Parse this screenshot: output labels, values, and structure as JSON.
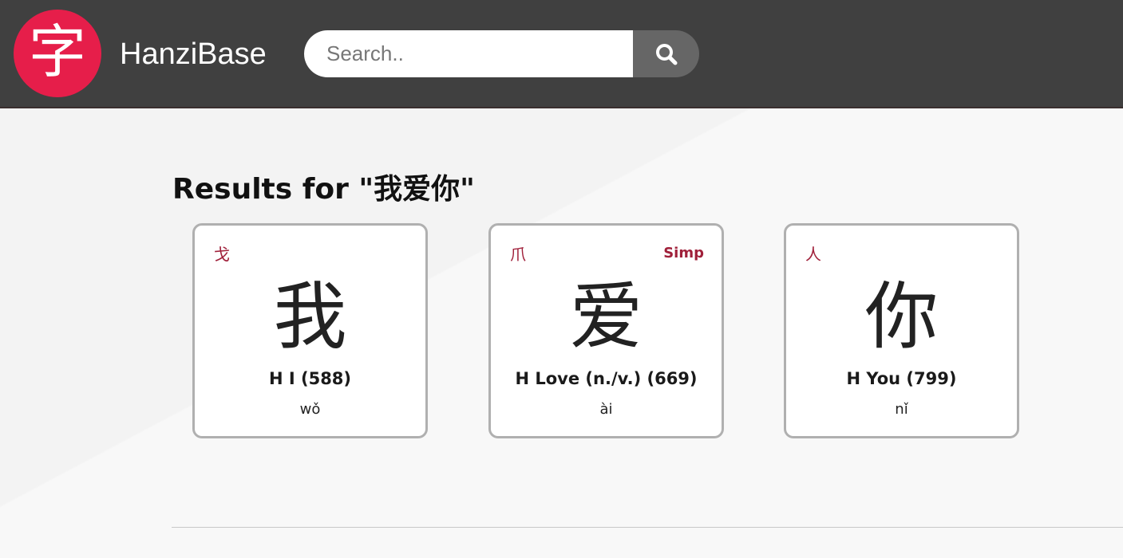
{
  "header": {
    "logo_glyph": "字",
    "brand": "HanziBase",
    "search": {
      "placeholder": "Search..",
      "value": ""
    },
    "search_button_icon": "search-icon"
  },
  "main": {
    "results_title": "Results for \"我爱你\"",
    "cards": [
      {
        "radical": "戈",
        "badge": "",
        "hanzi": "我",
        "meaning": "H I (588)",
        "pinyin": "wǒ"
      },
      {
        "radical": "爪",
        "badge": "Simp",
        "hanzi": "爱",
        "meaning": "H Love (n./v.) (669)",
        "pinyin": "ài"
      },
      {
        "radical": "人",
        "badge": "",
        "hanzi": "你",
        "meaning": "H You (799)",
        "pinyin": "nǐ"
      }
    ]
  },
  "colors": {
    "header_bg": "#404040",
    "logo_bg": "#e61e4a",
    "accent_red": "#a0203a",
    "search_button_bg": "#666666"
  }
}
